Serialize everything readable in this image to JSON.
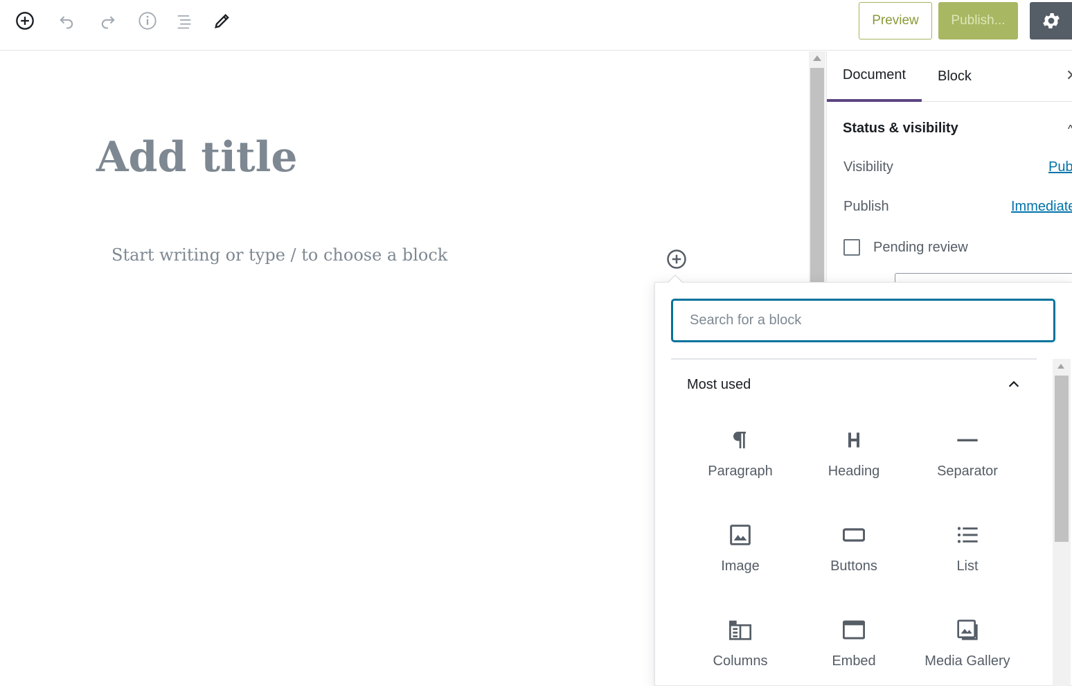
{
  "toolbar": {
    "preview_label": "Preview",
    "publish_label": "Publish..."
  },
  "editor": {
    "title_placeholder": "Add title",
    "paragraph_placeholder": "Start writing or type / to choose a block"
  },
  "sidebar": {
    "tabs": [
      {
        "label": "Document",
        "active": true
      },
      {
        "label": "Block",
        "active": false
      }
    ],
    "panel_title": "Status & visibility",
    "visibility_label": "Visibility",
    "visibility_value": "Pub",
    "publish_label": "Publish",
    "publish_value": "Immediate",
    "pending_review_label": "Pending review"
  },
  "inserter": {
    "search_placeholder": "Search for a block",
    "category_title": "Most used",
    "blocks": [
      {
        "label": "Paragraph",
        "icon": "paragraph-icon"
      },
      {
        "label": "Heading",
        "icon": "heading-icon"
      },
      {
        "label": "Separator",
        "icon": "separator-icon"
      },
      {
        "label": "Image",
        "icon": "image-icon"
      },
      {
        "label": "Buttons",
        "icon": "buttons-icon"
      },
      {
        "label": "List",
        "icon": "list-icon"
      },
      {
        "label": "Columns",
        "icon": "columns-icon"
      },
      {
        "label": "Embed",
        "icon": "embed-icon"
      },
      {
        "label": "Media Gallery",
        "icon": "gallery-icon"
      }
    ]
  },
  "colors": {
    "accent": "#0073aa",
    "tab_active": "#5b4482",
    "publish_bg": "#a8b762",
    "settings_bg": "#555d66"
  }
}
